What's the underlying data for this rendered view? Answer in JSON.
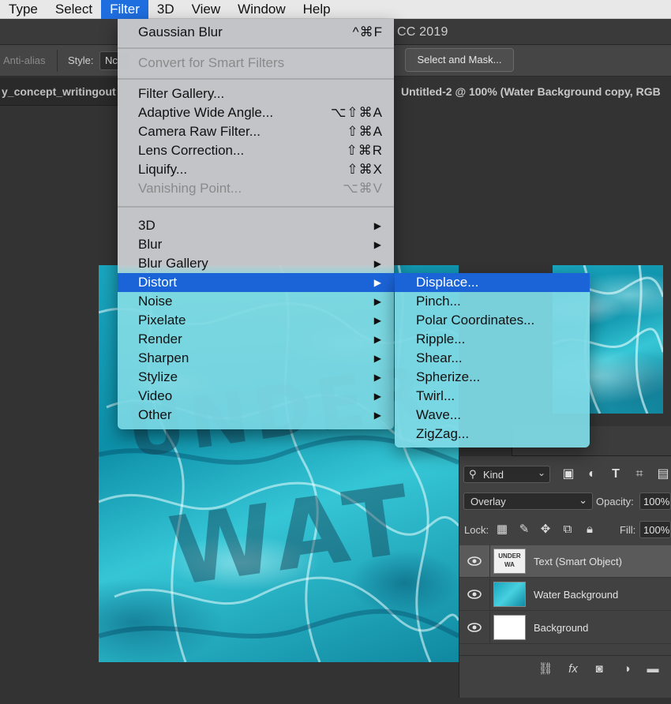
{
  "menubar": {
    "items": [
      "Type",
      "Select",
      "Filter",
      "3D",
      "View",
      "Window",
      "Help"
    ],
    "active": "Filter"
  },
  "app": {
    "title": "CC 2019"
  },
  "options_bar": {
    "antialias": "Anti-alias",
    "style_label": "Style:",
    "style_value": "Nc",
    "select_mask_label": "Select and Mask..."
  },
  "doc_tabs": [
    {
      "label": "y_concept_writingout"
    },
    {
      "label": "Untitled-2 @ 100% (Water Background copy, RGB"
    }
  ],
  "filter_menu": {
    "last_filter": {
      "label": "Gaussian Blur",
      "shortcut": "^⌘F"
    },
    "convert_smart": {
      "label": "Convert for Smart Filters"
    },
    "filter_gallery": {
      "label": "Filter Gallery..."
    },
    "adaptive": {
      "label": "Adaptive Wide Angle...",
      "shortcut": "⌥⇧⌘A"
    },
    "camera_raw": {
      "label": "Camera Raw Filter...",
      "shortcut": "⇧⌘A"
    },
    "lens": {
      "label": "Lens Correction...",
      "shortcut": "⇧⌘R"
    },
    "liquify": {
      "label": "Liquify...",
      "shortcut": "⇧⌘X"
    },
    "vanishing": {
      "label": "Vanishing Point...",
      "shortcut": "⌥⌘V"
    },
    "submenus": [
      "3D",
      "Blur",
      "Blur Gallery",
      "Distort",
      "Noise",
      "Pixelate",
      "Render",
      "Sharpen",
      "Stylize",
      "Video",
      "Other"
    ],
    "highlighted": "Distort"
  },
  "distort_submenu": {
    "items": [
      "Displace...",
      "Pinch...",
      "Polar Coordinates...",
      "Ripple...",
      "Shear...",
      "Spherize...",
      "Twirl...",
      "Wave...",
      "ZigZag..."
    ],
    "highlighted": "Displace..."
  },
  "canvas": {
    "ghost_line1": "UNDER",
    "ghost_line2": "WAT"
  },
  "layers_panel": {
    "filter_kind": "Kind",
    "blend_mode": "Overlay",
    "opacity_label": "Opacity:",
    "opacity_value": "100%",
    "lock_label": "Lock:",
    "fill_label": "Fill:",
    "fill_value": "100%",
    "text_thumb": "UNDER WA",
    "layers": [
      {
        "name": "Text (Smart Object)",
        "selected": true
      },
      {
        "name": "Water Background",
        "selected": false
      },
      {
        "name": "Background",
        "selected": false
      }
    ]
  },
  "colors": {
    "highlight": "#1b64d8",
    "menu_active": "#1f6ee0",
    "water": "#1aa6bf"
  }
}
